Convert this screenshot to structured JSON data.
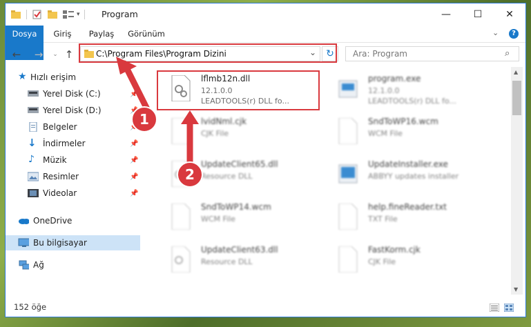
{
  "window": {
    "title": "Program"
  },
  "ribbon": {
    "tabs": [
      "Dosya",
      "Giriş",
      "Paylaş",
      "Görünüm"
    ]
  },
  "address": {
    "path": "C:\\Program Files\\Program Dizini"
  },
  "search": {
    "placeholder": "Ara: Program"
  },
  "sidebar": {
    "items": [
      {
        "label": "Hızlı erişim",
        "icon": "star-icon"
      },
      {
        "label": "Yerel Disk (C:)",
        "icon": "drive-icon"
      },
      {
        "label": "Yerel Disk (D:)",
        "icon": "drive-icon"
      },
      {
        "label": "Belgeler",
        "icon": "documents-icon"
      },
      {
        "label": "İndirmeler",
        "icon": "download-icon"
      },
      {
        "label": "Müzik",
        "icon": "music-icon"
      },
      {
        "label": "Resimler",
        "icon": "pictures-icon"
      },
      {
        "label": "Videolar",
        "icon": "video-icon"
      },
      {
        "label": "OneDrive",
        "icon": "cloud-icon"
      },
      {
        "label": "Bu bilgisayar",
        "icon": "computer-icon"
      },
      {
        "label": "Ağ",
        "icon": "network-icon"
      }
    ]
  },
  "files": [
    {
      "name": "lflmb12n.dll",
      "line2": "12.1.0.0",
      "line3": "LEADTOOLS(r) DLL fo..."
    },
    {
      "name": "program.exe",
      "line2": "12.1.0.0",
      "line3": "LEADTOOLS(r) DLL fo..."
    },
    {
      "name": "lvidNml.cjk",
      "line2": "CJK File",
      "line3": ""
    },
    {
      "name": "SndToWP16.wcm",
      "line2": "WCM File",
      "line3": ""
    },
    {
      "name": "UpdateClient65.dll",
      "line2": "Resource DLL",
      "line3": ""
    },
    {
      "name": "UpdateInstaller.exe",
      "line2": "ABBYY updates installer",
      "line3": ""
    },
    {
      "name": "SndToWP14.wcm",
      "line2": "WCM File",
      "line3": ""
    },
    {
      "name": "help.fineReader.txt",
      "line2": "TXT File",
      "line3": ""
    },
    {
      "name": "UpdateClient63.dll",
      "line2": "Resource DLL",
      "line3": ""
    },
    {
      "name": "FastKorm.cjk",
      "line2": "CJK File",
      "line3": ""
    }
  ],
  "status": {
    "count": "152 öğe"
  },
  "annotations": {
    "badge1": "1",
    "badge2": "2"
  },
  "colors": {
    "accent": "#1979ca",
    "highlight": "#d9393e",
    "selected": "#cde3f7"
  }
}
